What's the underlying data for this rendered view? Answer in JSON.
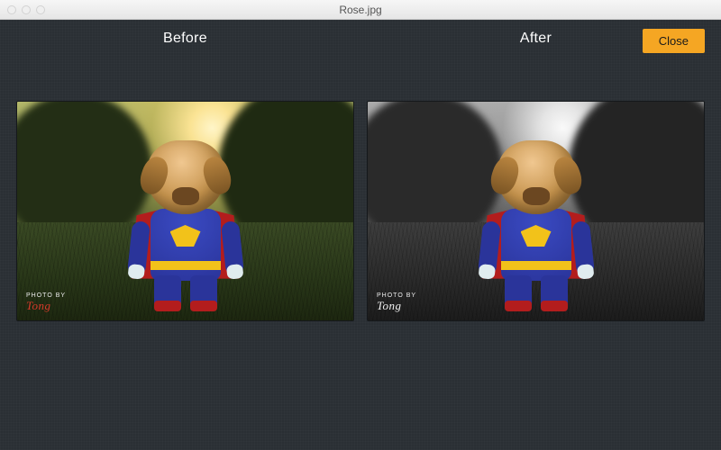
{
  "titlebar": {
    "filename": "Rose.jpg"
  },
  "labels": {
    "before": "Before",
    "after": "After"
  },
  "buttons": {
    "close": "Close"
  },
  "watermark": {
    "prefix": "PHOTO BY",
    "signature": "Tong"
  }
}
